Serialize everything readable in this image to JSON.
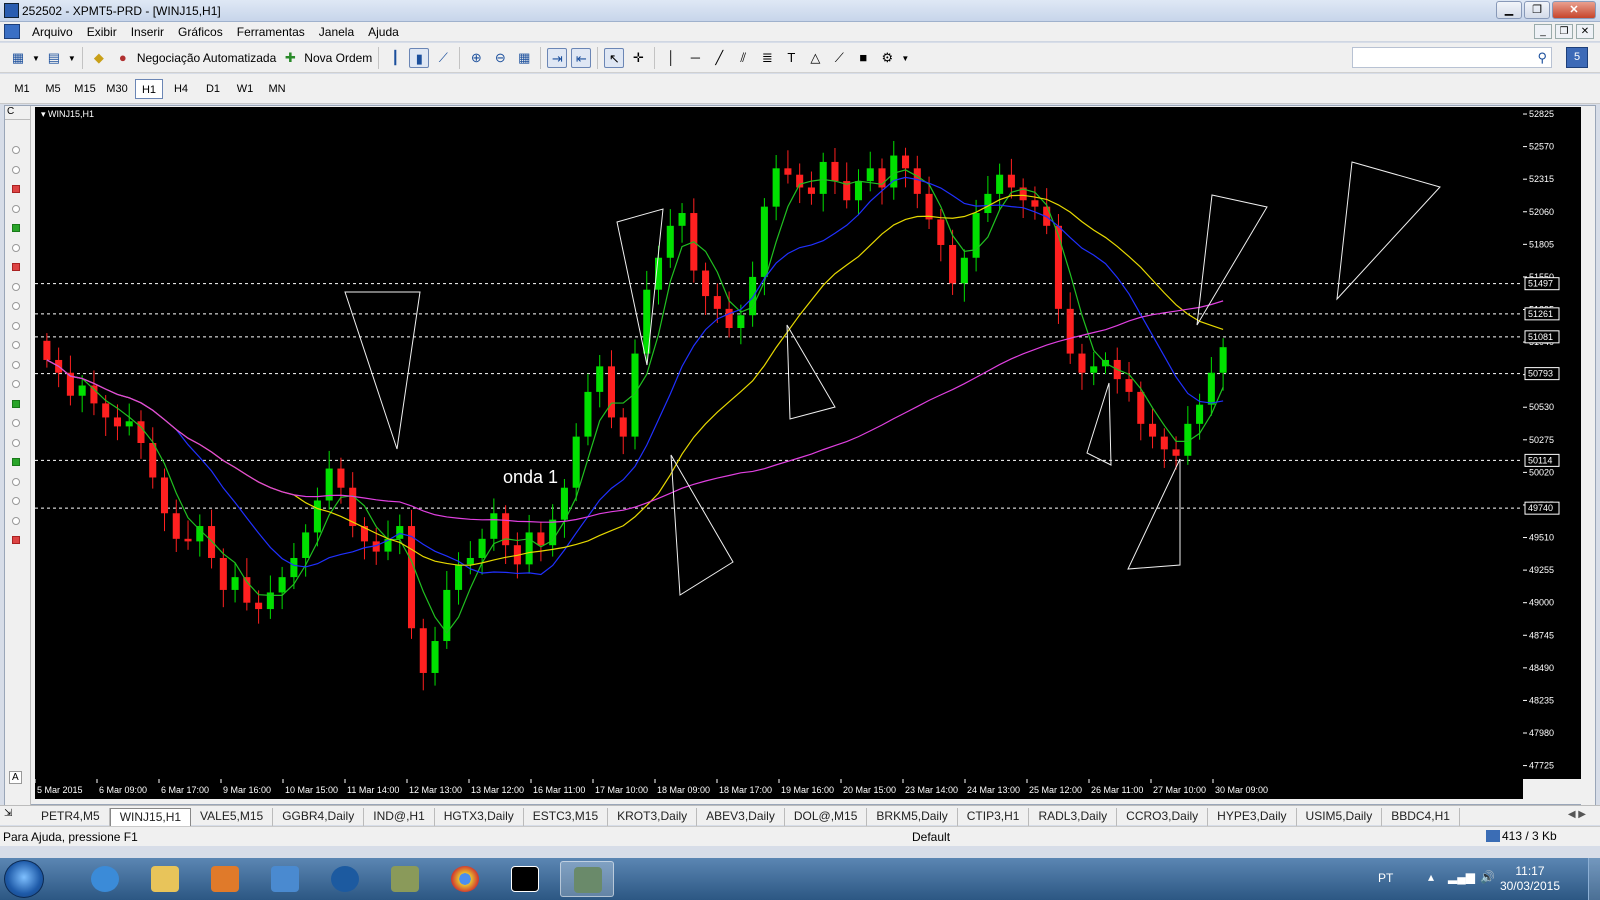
{
  "window": {
    "title": "252502 - XPMT5-PRD - [WINJ15,H1]"
  },
  "menu": [
    "Arquivo",
    "Exibir",
    "Inserir",
    "Gráficos",
    "Ferramentas",
    "Janela",
    "Ajuda"
  ],
  "toolbar": {
    "auto_trading_label": "Negociação Automatizada",
    "new_order_label": "Nova Ordem"
  },
  "timeframes": [
    "M1",
    "M5",
    "M15",
    "M30",
    "H1",
    "H4",
    "D1",
    "W1",
    "MN"
  ],
  "active_timeframe": "H1",
  "chart": {
    "symbol_label": "WINJ15,H1",
    "annotation": "onda 1",
    "sidebar_header": "C",
    "sidebar_footer": "A",
    "price_labels": [
      "52825",
      "52570",
      "52315",
      "52060",
      "51805",
      "51550",
      "51295",
      "51040",
      "50785",
      "50530",
      "50275",
      "50020",
      "49765",
      "49510",
      "49255",
      "49000",
      "48745",
      "48490",
      "48235",
      "47980",
      "47725"
    ],
    "level_labels": [
      "51497",
      "51261",
      "51081",
      "50793",
      "50114",
      "49740"
    ],
    "time_labels": [
      "5 Mar 2015",
      "6 Mar 09:00",
      "6 Mar 17:00",
      "9 Mar 16:00",
      "10 Mar 15:00",
      "11 Mar 14:00",
      "12 Mar 13:00",
      "13 Mar 12:00",
      "16 Mar 11:00",
      "17 Mar 10:00",
      "18 Mar 09:00",
      "18 Mar 17:00",
      "19 Mar 16:00",
      "20 Mar 15:00",
      "23 Mar 14:00",
      "24 Mar 13:00",
      "25 Mar 12:00",
      "26 Mar 11:00",
      "27 Mar 10:00",
      "30 Mar 09:00"
    ]
  },
  "chart_data": {
    "type": "candlestick",
    "symbol": "WINJ15",
    "timeframe": "H1",
    "ylim": [
      47620,
      52880
    ],
    "horizontal_levels": [
      51497,
      51261,
      51081,
      50793,
      50114,
      49740
    ],
    "closes_approx": [
      50900,
      50800,
      50620,
      50700,
      50560,
      50450,
      50380,
      50420,
      50250,
      49980,
      49700,
      49500,
      49480,
      49600,
      49350,
      49100,
      49200,
      49000,
      48950,
      49080,
      49200,
      49350,
      49550,
      49800,
      50050,
      49900,
      49600,
      49480,
      49400,
      49500,
      49600,
      48800,
      48450,
      48700,
      49100,
      49300,
      49350,
      49500,
      49700,
      49450,
      49300,
      49550,
      49450,
      49650,
      49900,
      50300,
      50650,
      50850,
      50450,
      50300,
      50950,
      51450,
      51700,
      51950,
      52050,
      51600,
      51400,
      51300,
      51150,
      51250,
      51550,
      52100,
      52400,
      52350,
      52250,
      52200,
      52450,
      52300,
      52150,
      52300,
      52400,
      52250,
      52500,
      52400,
      52200,
      52000,
      51800,
      51500,
      51700,
      52050,
      52200,
      52350,
      52250,
      52150,
      52100,
      51950,
      51300,
      50950,
      50800,
      50850,
      50900,
      50750,
      50650,
      50400,
      50300,
      50200,
      50150,
      50400,
      50550,
      50800,
      51000
    ]
  },
  "tabs": [
    "PETR4,M5",
    "WINJ15,H1",
    "VALE5,M15",
    "GGBR4,Daily",
    "IND@,H1",
    "HGTX3,Daily",
    "ESTC3,M15",
    "KROT3,Daily",
    "ABEV3,Daily",
    "DOL@,M15",
    "BRKM5,Daily",
    "CTIP3,H1",
    "RADL3,Daily",
    "CCRO3,Daily",
    "HYPE3,Daily",
    "USIM5,Daily",
    "BBDC4,H1"
  ],
  "active_tab": "WINJ15,H1",
  "status": {
    "help": "Para Ajuda, pressione F1",
    "profile": "Default",
    "traffic": "413 / 3 Kb"
  },
  "taskbar": {
    "lang": "PT",
    "time": "11:17",
    "date": "30/03/2015"
  },
  "colors": {
    "bull": "#00e000",
    "bear": "#ff2020",
    "ma_yellow": "#e6d800",
    "ma_blue": "#2030ff",
    "ma_magenta": "#e040e0",
    "ma_green": "#20c020"
  }
}
